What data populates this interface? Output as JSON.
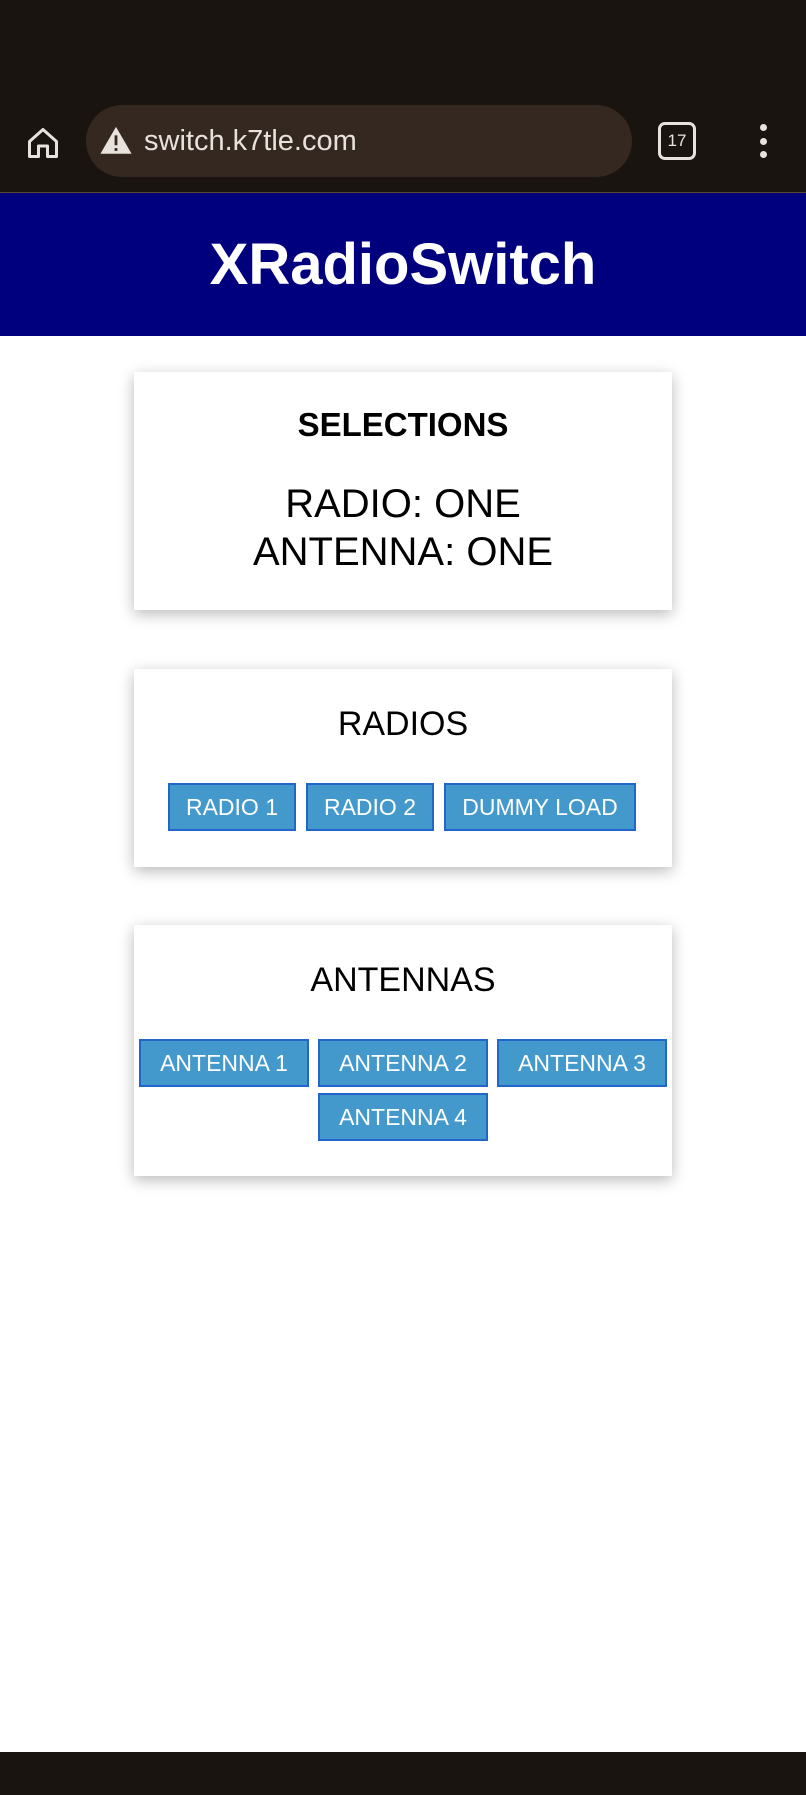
{
  "browser": {
    "url": "switch.k7tle.com",
    "tab_count": "17"
  },
  "header": {
    "title": "XRadioSwitch"
  },
  "selections": {
    "title": "SELECTIONS",
    "radio": "RADIO: ONE",
    "antenna": "ANTENNA: ONE"
  },
  "radios": {
    "title": "RADIOS",
    "buttons": [
      "RADIO 1",
      "RADIO 2",
      "DUMMY LOAD"
    ]
  },
  "antennas": {
    "title": "ANTENNAS",
    "buttons": [
      "ANTENNA 1",
      "ANTENNA 2",
      "ANTENNA 3",
      "ANTENNA 4"
    ]
  },
  "colors": {
    "header_bg": "#00007f",
    "button_bg": "#4499cc",
    "button_border": "#2266cc",
    "chrome_bg": "#1a1410"
  }
}
